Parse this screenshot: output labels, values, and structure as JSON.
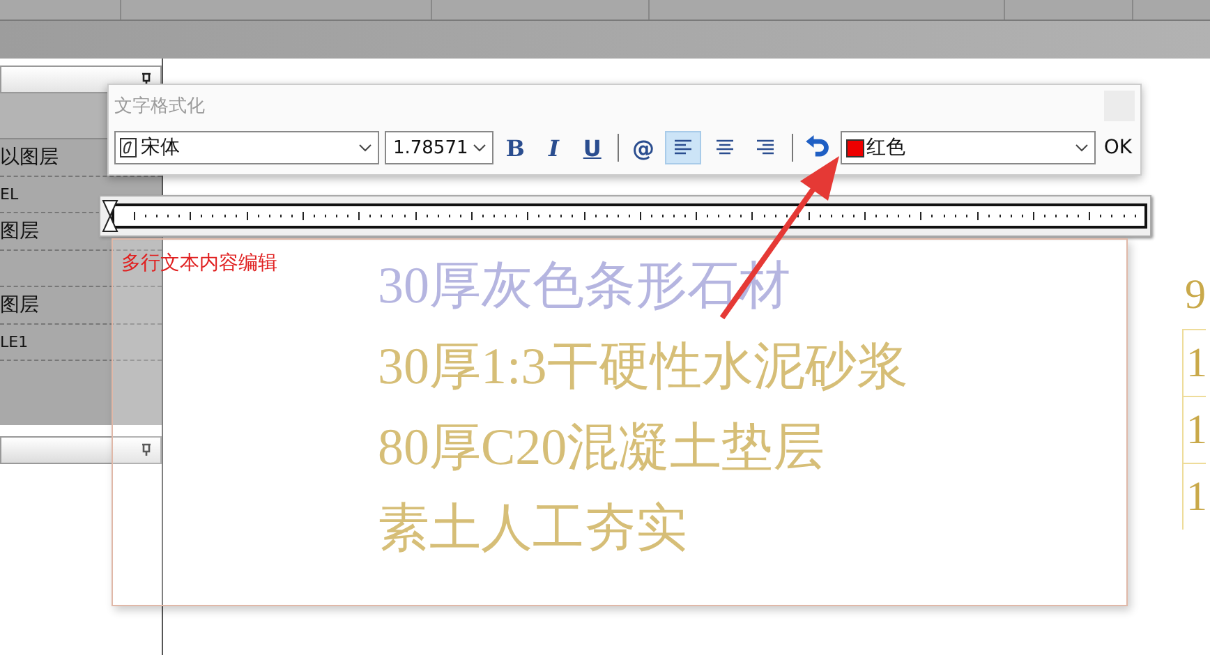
{
  "left_panel": {
    "rows": [
      {
        "text": "以图层",
        "kind": "layer"
      },
      {
        "text": "EL",
        "kind": "name"
      },
      {
        "text": "图层",
        "kind": "layer"
      },
      {
        "text": "",
        "kind": "blank"
      },
      {
        "text": "图层",
        "kind": "layer"
      },
      {
        "text": "LE1",
        "kind": "name"
      }
    ]
  },
  "drawing": {
    "texts": [
      {
        "text": "30厚灰色条形石材",
        "kind": "blue"
      },
      {
        "text": "30厚1:3干硬性水泥砂浆",
        "kind": "yellow"
      },
      {
        "text": "80厚C20混凝土垫层",
        "kind": "yellow"
      },
      {
        "text": "素土人工夯实",
        "kind": "yellow"
      }
    ],
    "table_cells": [
      "9",
      "1",
      "1",
      "1"
    ]
  },
  "dialog": {
    "title": "文字格式化",
    "font": "宋体",
    "size": "1.78571",
    "format_buttons": [
      {
        "label": "B",
        "kind": "bold"
      },
      {
        "label": "I",
        "kind": "italic"
      },
      {
        "label": "U",
        "kind": "underline"
      },
      {
        "label": "@",
        "kind": "symbol"
      }
    ],
    "align_buttons": [
      {
        "kind": "left",
        "selected": true
      },
      {
        "kind": "center",
        "selected": false
      },
      {
        "kind": "right",
        "selected": false
      }
    ],
    "color_name": "红色",
    "ok": "OK",
    "editor_text": "多行文本内容编辑"
  }
}
